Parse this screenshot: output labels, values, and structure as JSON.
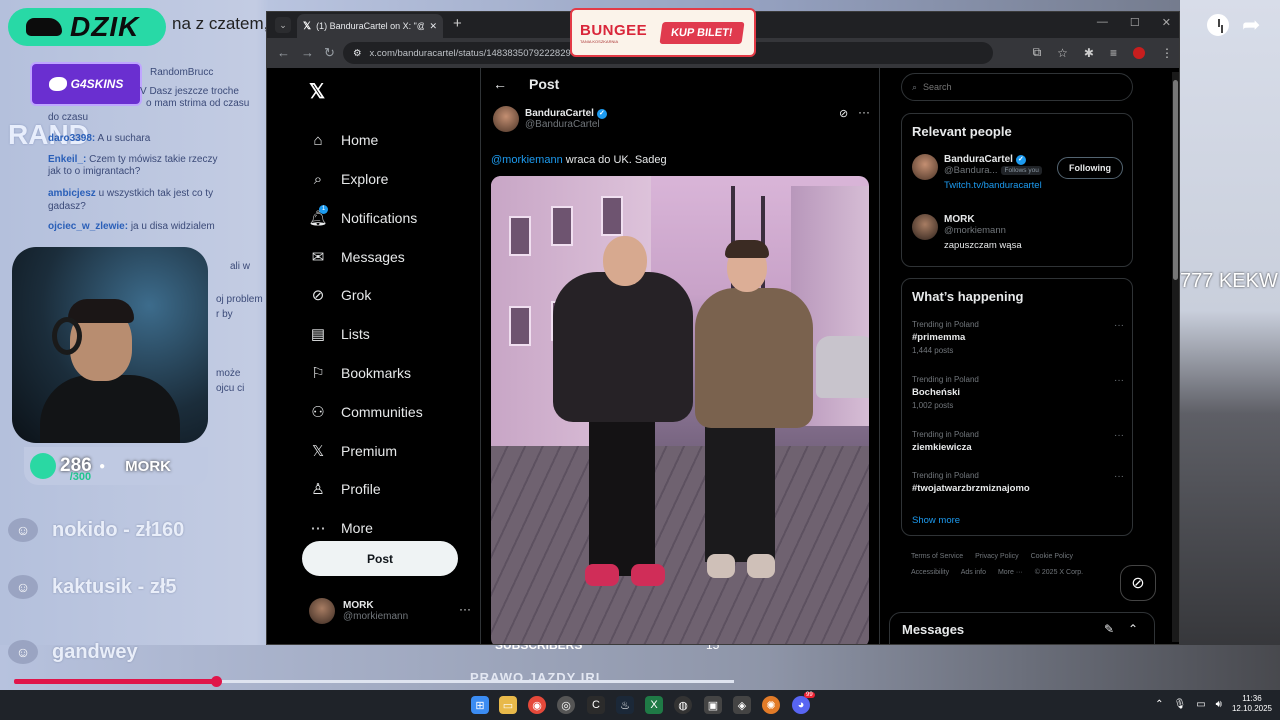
{
  "stream": {
    "brand": "DZIK",
    "chat_title_fragment": "na z czatem,",
    "sponsor": "G4SKINS",
    "vertical_text": "RAND",
    "chat_lines": [
      {
        "user": "",
        "text": "RandomBrucc"
      },
      {
        "user": "",
        "text": "V Dasz jeszcze troche"
      },
      {
        "user": "",
        "text": "o mam strima od czasu"
      },
      {
        "user": "",
        "text": "do czasu"
      },
      {
        "user": "daro3398:",
        "text": "A u suchara"
      },
      {
        "user": "Enkeil_:",
        "text": "Czem ty mówisz takie rzeczy"
      },
      {
        "user": "",
        "text": "jak to o imigrantach?"
      },
      {
        "user": "ambicjesz",
        "text": "u wszystkich tak jest co ty"
      },
      {
        "user": "",
        "text": "gadasz?"
      },
      {
        "user": "ojciec_w_zlewie:",
        "text": "ja u disa widzialem"
      }
    ],
    "webcam_side_lines": [
      "ali w",
      "oj problem",
      "r by",
      "może",
      "ojcu ci"
    ],
    "sub_count": "286",
    "sub_goal": "/300",
    "streamer_name": "MORK",
    "donors": [
      "nokido - zł160",
      "kaktusik - zł5",
      "gandwey"
    ],
    "right_overlay_text": "777 KEKW",
    "subscribers_label": "SUBSCRIBERS",
    "subscribers_count": "15",
    "bottom_label": "PRAWO JAZDY IRL",
    "video_progress": 0.28
  },
  "ad": {
    "brand": "BUNGEE",
    "brand_sub": "TANIA KOSZKARNIA",
    "cta": "KUP BILET!"
  },
  "browser": {
    "tab_title": "(1) BanduraCartel on X: \"@morc",
    "url": "x.com/banduracartel/status/1483835079222829"
  },
  "x": {
    "nav": [
      {
        "label": "Home",
        "icon": "home-icon"
      },
      {
        "label": "Explore",
        "icon": "search-icon"
      },
      {
        "label": "Notifications",
        "icon": "bell-icon",
        "badge": "1"
      },
      {
        "label": "Messages",
        "icon": "envelope-icon"
      },
      {
        "label": "Grok",
        "icon": "grok-icon"
      },
      {
        "label": "Lists",
        "icon": "list-icon"
      },
      {
        "label": "Bookmarks",
        "icon": "bookmark-icon"
      },
      {
        "label": "Communities",
        "icon": "communities-icon"
      },
      {
        "label": "Premium",
        "icon": "x-icon"
      },
      {
        "label": "Profile",
        "icon": "person-icon"
      },
      {
        "label": "More",
        "icon": "more-circle-icon"
      }
    ],
    "post_button": "Post",
    "account": {
      "name": "MORK",
      "handle": "@morkiemann"
    },
    "post": {
      "header": "Post",
      "author_name": "BanduraCartel",
      "author_handle": "@BanduraCartel",
      "mention": "@morkiemann",
      "text": " wraca do UK. Sadeg"
    },
    "search_placeholder": "Search",
    "relevant_people": {
      "title": "Relevant people",
      "people": [
        {
          "name": "BanduraCartel",
          "handle": "@Bandura...",
          "follows_you": "Follows you",
          "bio": "Twitch.tv/banduracartel",
          "button": "Following"
        },
        {
          "name": "MORK",
          "handle": "@morkiemann",
          "bio": "zapuszczam wąsa"
        }
      ]
    },
    "whats_happening": {
      "title": "What’s happening",
      "trends": [
        {
          "meta": "Trending in Poland",
          "name": "#primemma",
          "count": "1,444 posts"
        },
        {
          "meta": "Trending in Poland",
          "name": "Bocheński",
          "count": "1,002 posts"
        },
        {
          "meta": "Trending in Poland",
          "name": "ziemkiewicza",
          "count": ""
        },
        {
          "meta": "Trending in Poland",
          "name": "#twojatwarzbrzmiznajomo",
          "count": ""
        }
      ],
      "show_more": "Show more"
    },
    "footer": [
      "Terms of Service",
      "Privacy Policy",
      "Cookie Policy",
      "Accessibility",
      "Ads info",
      "More ···",
      "© 2025 X Corp."
    ],
    "messages_label": "Messages"
  },
  "taskbar": {
    "time": "11:36",
    "date": "12.10.2025",
    "discord_badge": "99"
  }
}
